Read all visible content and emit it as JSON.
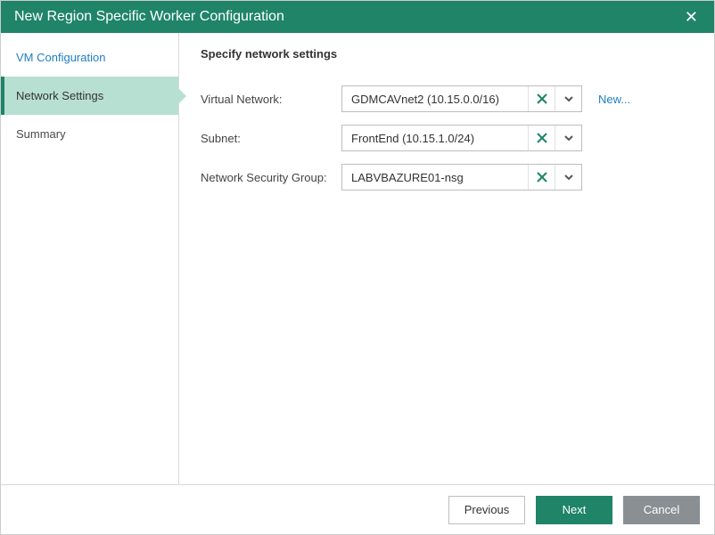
{
  "titlebar": {
    "title": "New Region Specific Worker Configuration"
  },
  "sidebar": {
    "items": [
      {
        "label": "VM Configuration"
      },
      {
        "label": "Network Settings"
      },
      {
        "label": "Summary"
      }
    ]
  },
  "content": {
    "heading": "Specify network settings",
    "rows": {
      "virtual_network": {
        "label": "Virtual Network:",
        "value": "GDMCAVnet2 (10.15.0.0/16)",
        "new_link": "New..."
      },
      "subnet": {
        "label": "Subnet:",
        "value": "FrontEnd (10.15.1.0/24)"
      },
      "nsg": {
        "label": "Network Security Group:",
        "value": "LABVBAZURE01-nsg"
      }
    }
  },
  "footer": {
    "previous": "Previous",
    "next": "Next",
    "cancel": "Cancel"
  }
}
